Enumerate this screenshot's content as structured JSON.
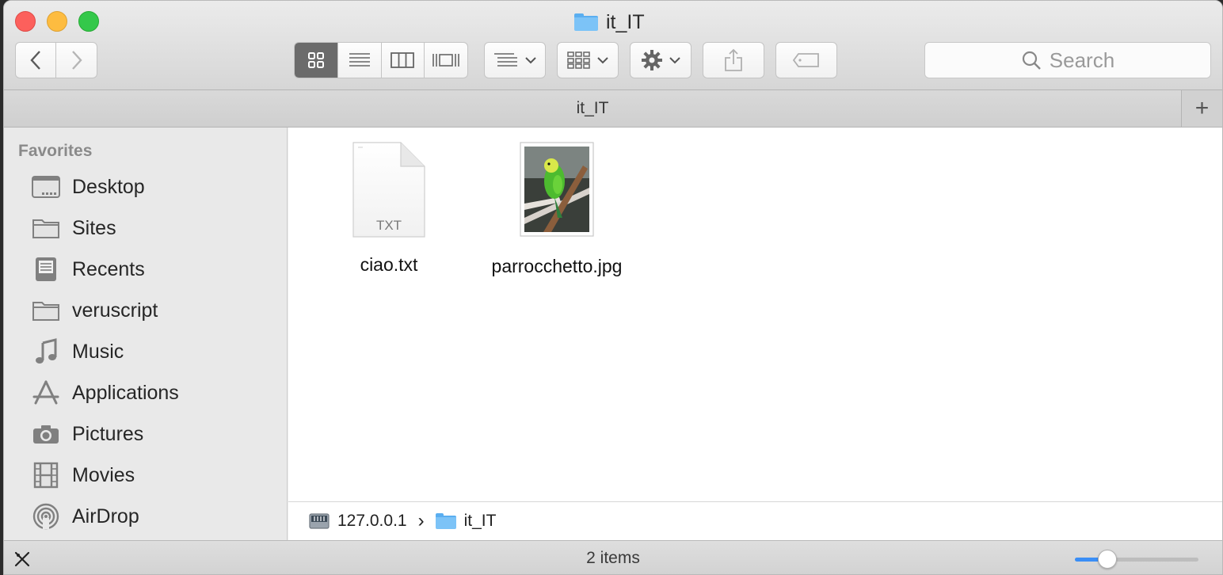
{
  "window": {
    "title": "it_IT"
  },
  "toolbar": {
    "back_icon": "chevron-left-icon",
    "forward_icon": "chevron-right-icon",
    "view_modes": [
      "icon-view",
      "list-view",
      "column-view",
      "cover-flow-view"
    ],
    "active_view": "icon-view",
    "search_placeholder": "Search"
  },
  "pathbar": {
    "tab_label": "it_IT",
    "add_tab_symbol": "+"
  },
  "sidebar": {
    "heading": "Favorites",
    "items": [
      {
        "label": "Desktop",
        "icon": "desktop-icon"
      },
      {
        "label": "Sites",
        "icon": "folder-icon"
      },
      {
        "label": "Recents",
        "icon": "recents-icon"
      },
      {
        "label": "veruscript",
        "icon": "folder-icon"
      },
      {
        "label": "Music",
        "icon": "music-icon"
      },
      {
        "label": "Applications",
        "icon": "applications-icon"
      },
      {
        "label": "Pictures",
        "icon": "camera-icon"
      },
      {
        "label": "Movies",
        "icon": "film-icon"
      },
      {
        "label": "AirDrop",
        "icon": "airdrop-icon"
      }
    ]
  },
  "files": [
    {
      "name": "ciao.txt",
      "kind_label": "TXT",
      "icon": "text-document-icon"
    },
    {
      "name": "parrocchetto.jpg",
      "icon": "image-thumbnail-icon"
    }
  ],
  "breadcrumb": {
    "server": "127.0.0.1",
    "folder": "it_IT",
    "separator": "›"
  },
  "status": {
    "item_count": "2 items",
    "icon_size_fraction": 0.26
  },
  "colors": {
    "folder_blue": "#7cc3f7",
    "accent": "#3a8ef6",
    "close": "#fc605c",
    "minimize": "#fdbc40",
    "zoom": "#34c84a"
  }
}
